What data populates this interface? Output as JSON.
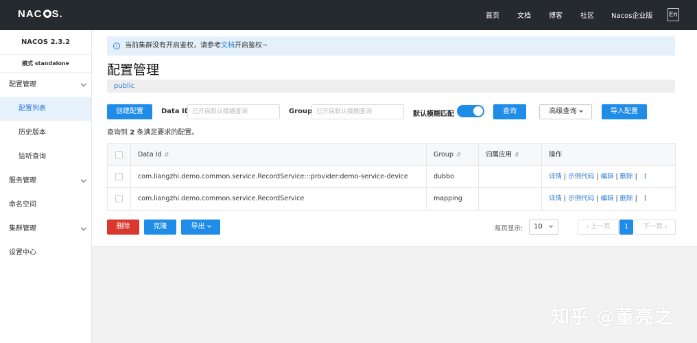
{
  "header": {
    "logo": {
      "part1": "NAC",
      "part2": "S."
    },
    "nav": [
      "首页",
      "文档",
      "博客",
      "社区",
      "Nacos企业版"
    ],
    "lang_button": "En"
  },
  "sidebar": {
    "version": "NACOS 2.3.2",
    "mode": "模式 standalone",
    "items": [
      {
        "label": "配置管理",
        "expandable": true
      },
      {
        "label": "配置列表",
        "active": true
      },
      {
        "label": "历史版本"
      },
      {
        "label": "监听查询"
      },
      {
        "label": "服务管理",
        "expandable": true
      },
      {
        "label": "命名空间"
      },
      {
        "label": "集群管理",
        "expandable": true
      },
      {
        "label": "设置中心"
      }
    ]
  },
  "notice": {
    "text_before": "当前集群没有开启鉴权，请参考",
    "link": "文档",
    "text_after": "开启鉴权~"
  },
  "page_title": "配置管理",
  "namespace": "public",
  "toolbar": {
    "create_label": "创建配置",
    "data_id_label": "Data ID",
    "data_id_placeholder": "已开启默认模糊查询",
    "group_label": "Group",
    "group_placeholder": "已开启默认模糊查询",
    "fuzzy_label": "默认模糊匹配",
    "fuzzy_on": true,
    "query_label": "查询",
    "advanced_label": "高级查询",
    "import_label": "导入配置"
  },
  "summary": {
    "prefix": "查询到",
    "count": "2",
    "suffix": "条满足要求的配置。"
  },
  "table": {
    "headers": {
      "data_id": "Data Id",
      "group": "Group",
      "app": "归属应用",
      "ops": "操作"
    },
    "rows": [
      {
        "data_id": "com.liangzhi.demo.common.service.RecordService:::provider:demo-service-device",
        "group": "dubbo",
        "app": ""
      },
      {
        "data_id": "com.liangzhi.demo.common.service.RecordService",
        "group": "mapping",
        "app": ""
      }
    ],
    "ops": {
      "detail": "详情",
      "sample": "示例代码",
      "edit": "编辑",
      "delete": "删除"
    }
  },
  "bottom": {
    "delete_label": "删除",
    "clone_label": "克隆",
    "export_label": "导出"
  },
  "pagination": {
    "page_size_label": "每页显示:",
    "page_size": "10",
    "prev": "上一页",
    "current": "1",
    "next": "下一页"
  },
  "watermark": "知乎 @董亮之",
  "colors": {
    "primary": "#1f8ce8",
    "danger": "#d9382f",
    "topbar": "#252a2f",
    "link": "#2a7bd4"
  }
}
